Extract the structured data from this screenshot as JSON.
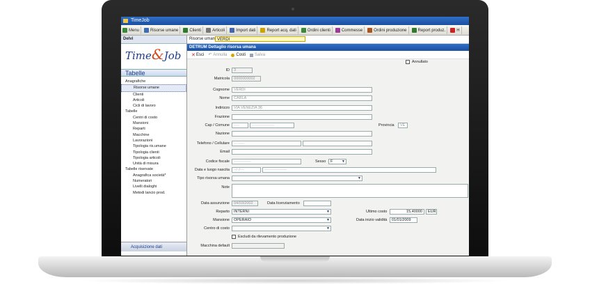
{
  "window": {
    "title": "TimeJob"
  },
  "toolbar": {
    "items": [
      {
        "label": "Menu",
        "icon": "menu-icon",
        "color": "#3a8a3a"
      },
      {
        "label": "Risorse umane",
        "icon": "people-icon",
        "color": "#3a6fb5"
      },
      {
        "label": "Clienti",
        "icon": "handshake-icon",
        "color": "#2f7a2f"
      },
      {
        "label": "Articoli",
        "icon": "gears-icon",
        "color": "#777777"
      },
      {
        "label": "Import dati",
        "icon": "import-icon",
        "color": "#4466aa"
      },
      {
        "label": "Report acq. dati",
        "icon": "report-icon",
        "color": "#c9a400"
      },
      {
        "label": "Ordini clienti",
        "icon": "orders-icon",
        "color": "#3a8a3a"
      },
      {
        "label": "Commesse",
        "icon": "jobs-icon",
        "color": "#9a3a9a"
      },
      {
        "label": "Ordini produzione",
        "icon": "production-icon",
        "color": "#aa5522"
      },
      {
        "label": "Report produz.",
        "icon": "chart-icon",
        "color": "#2f7a2f"
      },
      {
        "label": "H",
        "icon": "exit-icon",
        "color": "#cc2222"
      }
    ]
  },
  "sidebar": {
    "header": "Delvi",
    "logo": {
      "part1": "Time",
      "amp": "&",
      "part2": "Job"
    },
    "section": "Tabelle",
    "tree": [
      {
        "label": "Anagrafiche",
        "level": 0
      },
      {
        "label": "Risorse umane",
        "level": 1,
        "selected": true
      },
      {
        "label": "Clienti",
        "level": 1
      },
      {
        "label": "Articoli",
        "level": 1
      },
      {
        "label": "Cicli di lavoro",
        "level": 1
      },
      {
        "label": "Tabelle",
        "level": 0
      },
      {
        "label": "Centri di costo",
        "level": 1
      },
      {
        "label": "Mansioni",
        "level": 1
      },
      {
        "label": "Reparti",
        "level": 1
      },
      {
        "label": "Macchine",
        "level": 1
      },
      {
        "label": "Lavorazioni",
        "level": 1
      },
      {
        "label": "Tipologia ris.umane",
        "level": 1
      },
      {
        "label": "Tipologia clienti",
        "level": 1
      },
      {
        "label": "Tipologia articoli",
        "level": 1
      },
      {
        "label": "Unità di misura",
        "level": 1
      },
      {
        "label": "Tabelle riservate",
        "level": 0
      },
      {
        "label": "Anagrafica società*",
        "level": 1
      },
      {
        "label": "Numeratori",
        "level": 1
      },
      {
        "label": "Livelli dialoghi",
        "level": 1
      },
      {
        "label": "Metodi lancio prod.",
        "level": 1
      }
    ],
    "bottom": "Acquisizione dati"
  },
  "crumb": {
    "label": "Risorse umane",
    "value": "VERDI"
  },
  "detail": {
    "title": "DETRUM Dettaglio risorsa umana"
  },
  "actions": {
    "exit": "Esci",
    "cancel": "Annulla",
    "costs": "Costi",
    "save": "Salva"
  },
  "form": {
    "annullato": "Annullato",
    "id_label": "ID",
    "id_value": "3",
    "matricola_label": "Matricola",
    "matricola_value": "0000000002",
    "cognome_label": "Cognome",
    "cognome_value": "VERDI",
    "nome_label": "Nome",
    "nome_value": "CARLA",
    "indirizzo_label": "Indirizzo",
    "indirizzo_value": "VIA VENEZIA 36",
    "frazione_label": "Frazione",
    "cap_label": "Cap / Comune",
    "cap_value": "-----",
    "comune_value": "---------------------",
    "provincia_label": "Provincia",
    "provincia_value": "VE",
    "nazione_label": "Nazione",
    "telefono_label": "Telefono / Cellulare",
    "telefono_value": "--- ------",
    "email_label": "Email",
    "cf_label": "Codice fiscale",
    "cf_value": "----------------",
    "sesso_label": "Sesso",
    "sesso_value": "F",
    "nascita_label": "Data e luogo nascita",
    "nascita_data": "--/--/----",
    "nascita_luogo": "---------------------",
    "tipo_label": "Tipo risorsa umana",
    "note_label": "Note",
    "assunzione_label": "Data assunzione",
    "assunzione_value": "04/03/2002",
    "licenziamento_label": "Data licenziamento",
    "reparto_label": "Reparto",
    "reparto_value": "INTERNI",
    "ultimo_costo_label": "Ultimo costo",
    "ultimo_costo_value": "15,40000",
    "currency": "EUR",
    "mansione_label": "Mansione",
    "mansione_value": "OPERAIO",
    "validita_label": "Data inizio validità",
    "validita_value": "01/01/2009",
    "centro_label": "Centro di costo",
    "escludi_label": "Escludi da rilevamento produzione",
    "macchina_label": "Macchina default"
  },
  "colors": {
    "titlebar": "#1b4fa0",
    "accent": "#d24a1c",
    "selected": "#e4ebf6"
  }
}
